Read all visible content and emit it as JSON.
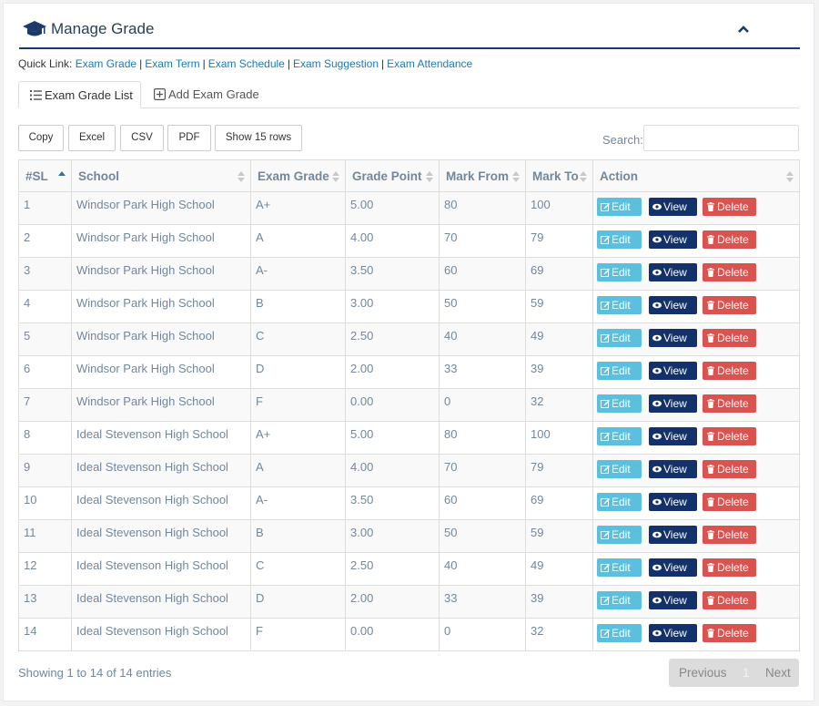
{
  "header": {
    "title": "Manage Grade",
    "icons": {
      "title_icon": "graduation-cap-icon",
      "collapse_icon": "chevron-up-icon"
    }
  },
  "quick_links": {
    "label": "Quick Link:",
    "links": [
      "Exam Grade",
      "Exam Term",
      "Exam Schedule",
      "Exam Suggestion",
      "Exam Attendance"
    ]
  },
  "tabs": [
    {
      "label": "Exam Grade List",
      "icon": "list-ol-icon",
      "active": true
    },
    {
      "label": "Add Exam Grade",
      "icon": "plus-square-icon",
      "active": false
    }
  ],
  "toolbar": {
    "buttons": [
      "Copy",
      "Excel",
      "CSV",
      "PDF",
      "Show 15 rows"
    ],
    "search_label": "Search:",
    "search_value": ""
  },
  "table": {
    "columns": [
      "#SL",
      "School",
      "Exam Grade",
      "Grade Point",
      "Mark From",
      "Mark To",
      "Action"
    ],
    "action_labels": {
      "edit": "Edit",
      "view": "View",
      "delete": "Delete"
    },
    "rows": [
      [
        "1",
        "Windsor Park High School",
        "A+",
        "5.00",
        "80",
        "100"
      ],
      [
        "2",
        "Windsor Park High School",
        "A",
        "4.00",
        "70",
        "79"
      ],
      [
        "3",
        "Windsor Park High School",
        "A-",
        "3.50",
        "60",
        "69"
      ],
      [
        "4",
        "Windsor Park High School",
        "B",
        "3.00",
        "50",
        "59"
      ],
      [
        "5",
        "Windsor Park High School",
        "C",
        "2.50",
        "40",
        "49"
      ],
      [
        "6",
        "Windsor Park High School",
        "D",
        "2.00",
        "33",
        "39"
      ],
      [
        "7",
        "Windsor Park High School",
        "F",
        "0.00",
        "0",
        "32"
      ],
      [
        "8",
        "Ideal Stevenson High School",
        "A+",
        "5.00",
        "80",
        "100"
      ],
      [
        "9",
        "Ideal Stevenson High School",
        "A",
        "4.00",
        "70",
        "79"
      ],
      [
        "10",
        "Ideal Stevenson High School",
        "A-",
        "3.50",
        "60",
        "69"
      ],
      [
        "11",
        "Ideal Stevenson High School",
        "B",
        "3.00",
        "50",
        "59"
      ],
      [
        "12",
        "Ideal Stevenson High School",
        "C",
        "2.50",
        "40",
        "49"
      ],
      [
        "13",
        "Ideal Stevenson High School",
        "D",
        "2.00",
        "33",
        "39"
      ],
      [
        "14",
        "Ideal Stevenson High School",
        "F",
        "0.00",
        "0",
        "32"
      ]
    ]
  },
  "footer": {
    "info": "Showing 1 to 14 of 14 entries",
    "pagination": {
      "previous": "Previous",
      "current": "1",
      "next": "Next"
    }
  },
  "colors": {
    "brand": "#1b3a6b",
    "link": "#1a7ab9",
    "edit": "#5bc0de",
    "view": "#13316b",
    "delete": "#d9534f"
  }
}
